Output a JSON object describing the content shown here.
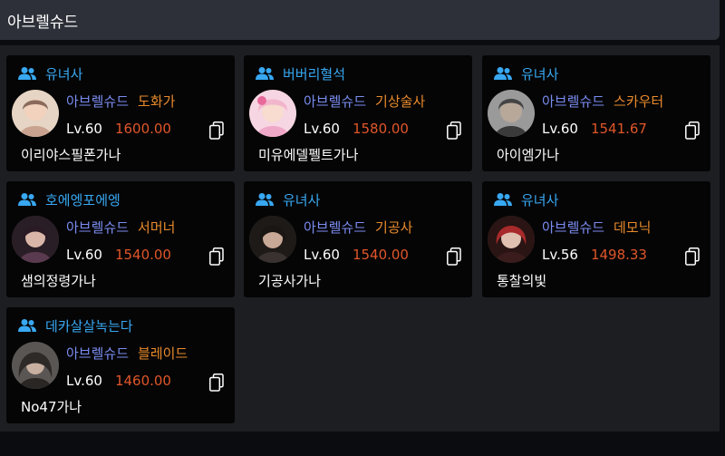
{
  "header": {
    "title": "아브렐슈드"
  },
  "cards": [
    {
      "group": "유녀사",
      "server": "아브렐슈드",
      "class": "도화가",
      "level": "Lv.60",
      "item_level": "1600.00",
      "name": "이리야스필폰가나",
      "avatar_color": "#c9a38f"
    },
    {
      "group": "버버리혈석",
      "server": "아브렐슈드",
      "class": "기상술사",
      "level": "Lv.60",
      "item_level": "1580.00",
      "name": "미유에델펠트가나",
      "avatar_color": "#f0a8c8"
    },
    {
      "group": "유녀사",
      "server": "아브렐슈드",
      "class": "스카우터",
      "level": "Lv.60",
      "item_level": "1541.67",
      "name": "아이엠가나",
      "avatar_color": "#6a6a6a"
    },
    {
      "group": "호에엥포에엥",
      "server": "아브렐슈드",
      "class": "서머너",
      "level": "Lv.60",
      "item_level": "1540.00",
      "name": "샘의정령가나",
      "avatar_color": "#5a3a4e"
    },
    {
      "group": "유녀사",
      "server": "아브렐슈드",
      "class": "기공사",
      "level": "Lv.60",
      "item_level": "1540.00",
      "name": "기공사가나",
      "avatar_color": "#3a3230"
    },
    {
      "group": "유녀사",
      "server": "아브렐슈드",
      "class": "데모닉",
      "level": "Lv.56",
      "item_level": "1498.33",
      "name": "통찰의빛",
      "avatar_color": "#8a2a2a"
    },
    {
      "group": "데카살살녹는다",
      "server": "아브렐슈드",
      "class": "블레이드",
      "level": "Lv.60",
      "item_level": "1460.00",
      "name": "No47가나",
      "avatar_color": "#4a4644"
    }
  ],
  "icons": {
    "group": "users-icon",
    "copy": "copy-icon"
  }
}
